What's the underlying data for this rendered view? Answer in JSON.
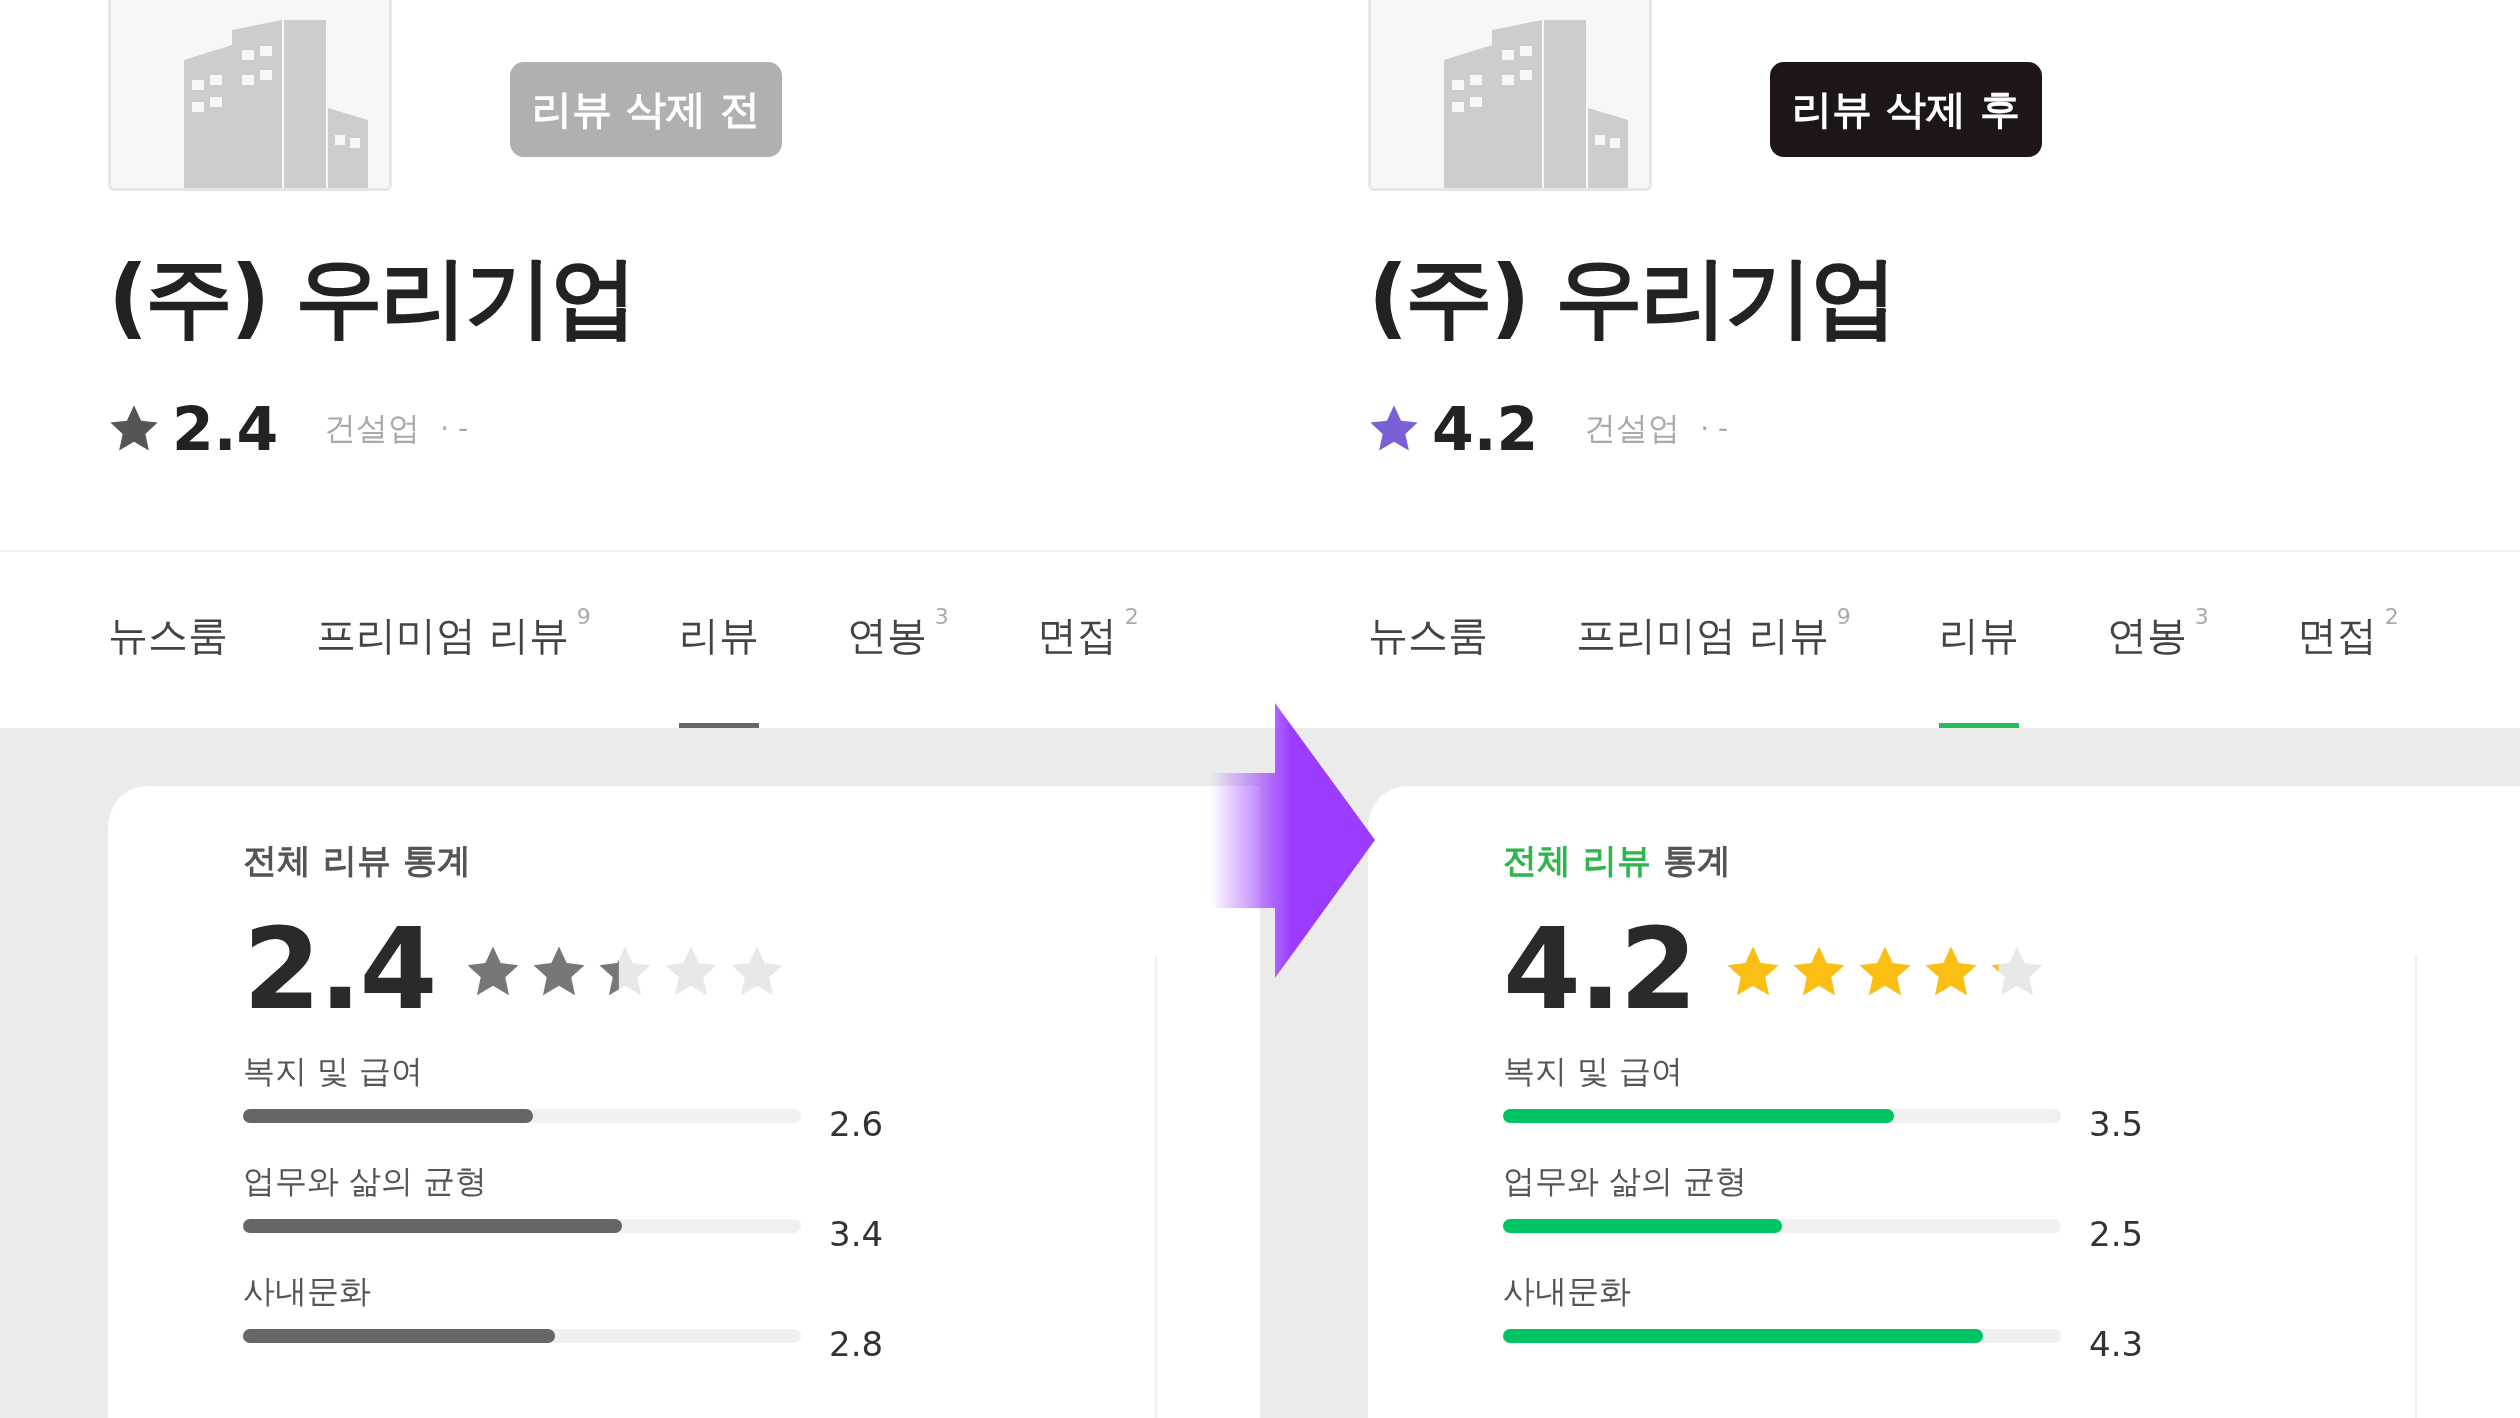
{
  "panels": [
    {
      "kind": "monochrome",
      "badge": "리뷰 삭제 전",
      "company": "(주) 우리기업",
      "rating": "2.4",
      "industry": "건설업",
      "industry_suffix": "· -",
      "tabs": [
        {
          "label": "뉴스룸",
          "selected": false
        },
        {
          "label": "프리미엄 리뷰",
          "count": "9",
          "selected": false
        },
        {
          "label": "리뷰",
          "selected": true
        },
        {
          "label": "연봉",
          "count": "3",
          "selected": false
        },
        {
          "label": "면접",
          "count": "2",
          "selected": false
        }
      ],
      "stats": {
        "title_parts": [
          {
            "text": "전체 리뷰",
            "highlighted": false
          },
          {
            "text": "통계",
            "highlighted": false
          }
        ],
        "score": "2.4",
        "stars": 2.4,
        "metrics": [
          {
            "label": "복지 및 급여",
            "level": 0.52,
            "value": "2.6"
          },
          {
            "label": "업무와 삶의 균형",
            "level": 0.68,
            "value": "3.4"
          },
          {
            "label": "사내문화",
            "level": 0.56,
            "value": "2.8"
          }
        ]
      }
    },
    {
      "kind": "color",
      "badge": "리뷰 삭제 후",
      "company": "(주) 우리기업",
      "rating": "4.2",
      "industry": "건설업",
      "industry_suffix": "· -",
      "tabs": [
        {
          "label": "뉴스룸",
          "selected": false
        },
        {
          "label": "프리미엄 리뷰",
          "count": "9",
          "selected": false
        },
        {
          "label": "리뷰",
          "selected": true
        },
        {
          "label": "연봉",
          "count": "3",
          "selected": false
        },
        {
          "label": "면접",
          "count": "2",
          "selected": false
        }
      ],
      "stats": {
        "title_parts": [
          {
            "text": "전체 리뷰",
            "highlighted": true
          },
          {
            "text": "통계",
            "highlighted": false
          }
        ],
        "score": "4.2",
        "stars": 4.2,
        "metrics": [
          {
            "label": "복지 및 급여",
            "level": 0.7,
            "value": "3.5"
          },
          {
            "label": "업무와 삶의 균형",
            "level": 0.5,
            "value": "2.5"
          },
          {
            "label": "사내문화",
            "level": 0.86,
            "value": "4.3"
          }
        ]
      }
    }
  ]
}
